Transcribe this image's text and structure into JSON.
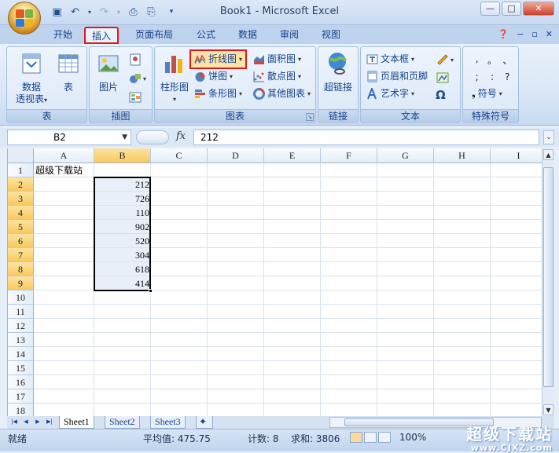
{
  "window": {
    "title": "Book1 - Microsoft Excel"
  },
  "tabs": [
    {
      "label": "开始"
    },
    {
      "label": "插入"
    },
    {
      "label": "页面布局"
    },
    {
      "label": "公式"
    },
    {
      "label": "数据"
    },
    {
      "label": "审阅"
    },
    {
      "label": "视图"
    }
  ],
  "ribbon": {
    "tables": {
      "label": "表",
      "pivot_line1": "数据",
      "pivot_line2": "透视表",
      "table": "表"
    },
    "illustrations": {
      "label": "插图",
      "picture": "图片"
    },
    "charts": {
      "label": "图表",
      "column": "柱形图",
      "line": "折线图",
      "pie": "饼图",
      "bar": "条形图",
      "area": "面积图",
      "scatter": "散点图",
      "other": "其他图表"
    },
    "links": {
      "label": "链接",
      "hyperlink": "超链接"
    },
    "text": {
      "label": "文本",
      "textbox": "文本框",
      "header_footer": "页眉和页脚",
      "wordart": "艺术字"
    },
    "symbols": {
      "label": "特殊符号",
      "symbol": "符号"
    }
  },
  "formula_bar": {
    "name_box": "B2",
    "fx": "fx",
    "value": "212"
  },
  "grid": {
    "columns": [
      "A",
      "B",
      "C",
      "D",
      "E",
      "F",
      "G",
      "H",
      "I"
    ],
    "rows": [
      "1",
      "2",
      "3",
      "4",
      "5",
      "6",
      "7",
      "8",
      "9",
      "10",
      "11",
      "12",
      "13",
      "14",
      "15",
      "16",
      "17",
      "18"
    ],
    "a1": "超级下载站",
    "b_values": [
      "212",
      "726",
      "110",
      "902",
      "520",
      "304",
      "618",
      "414"
    ]
  },
  "sheets": [
    "Sheet1",
    "Sheet2",
    "Sheet3"
  ],
  "status": {
    "ready": "就绪",
    "average": "平均值: 475.75",
    "count": "计数: 8",
    "sum": "求和: 3806",
    "zoom": "100%"
  },
  "watermark": {
    "line1": "超级下载站",
    "line2": "www.CJXZ.com"
  }
}
